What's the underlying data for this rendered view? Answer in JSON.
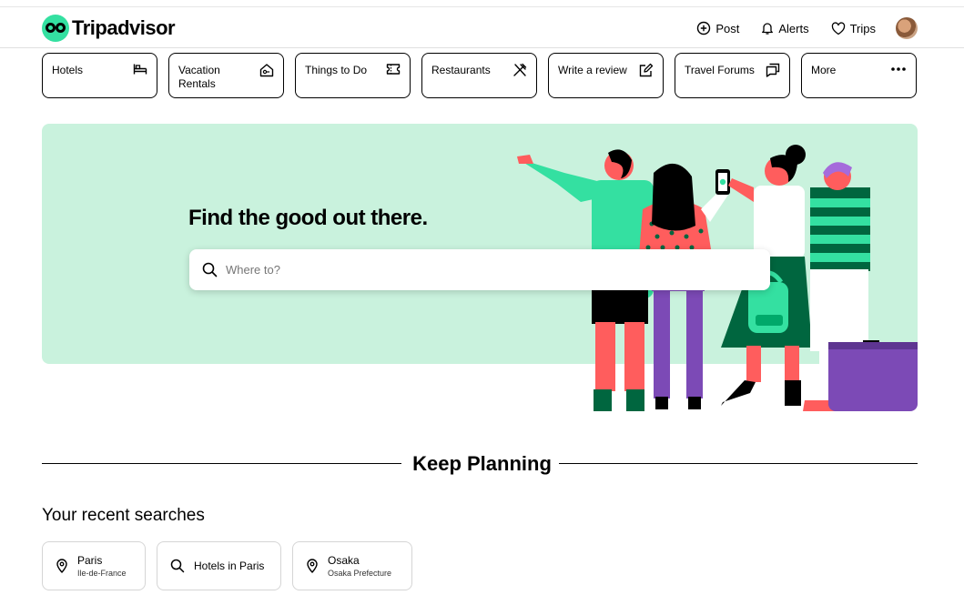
{
  "brand": {
    "name": "Tripadvisor",
    "accent": "#34e0a1"
  },
  "header": {
    "actions": [
      {
        "label": "Post",
        "icon": "plus-circle-icon"
      },
      {
        "label": "Alerts",
        "icon": "bell-icon"
      },
      {
        "label": "Trips",
        "icon": "heart-icon"
      }
    ]
  },
  "nav": {
    "items": [
      {
        "label": "Hotels",
        "icon": "bed-icon"
      },
      {
        "label": "Vacation Rentals",
        "icon": "house-icon"
      },
      {
        "label": "Things to Do",
        "icon": "ticket-icon"
      },
      {
        "label": "Restaurants",
        "icon": "utensils-icon"
      },
      {
        "label": "Write a review",
        "icon": "edit-icon"
      },
      {
        "label": "Travel Forums",
        "icon": "chat-icon"
      },
      {
        "label": "More",
        "icon": "more-icon"
      }
    ]
  },
  "hero": {
    "title": "Find the good out there.",
    "search_placeholder": "Where to?",
    "background": "#c9f2dd"
  },
  "planning": {
    "title": "Keep Planning",
    "recent_title": "Your recent searches",
    "recent": [
      {
        "title": "Paris",
        "subtitle": "Ile-de-France",
        "icon": "location-pin-icon"
      },
      {
        "title": "Hotels in Paris",
        "subtitle": "",
        "icon": "search-icon"
      },
      {
        "title": "Osaka",
        "subtitle": "Osaka Prefecture",
        "icon": "location-pin-icon"
      }
    ]
  }
}
